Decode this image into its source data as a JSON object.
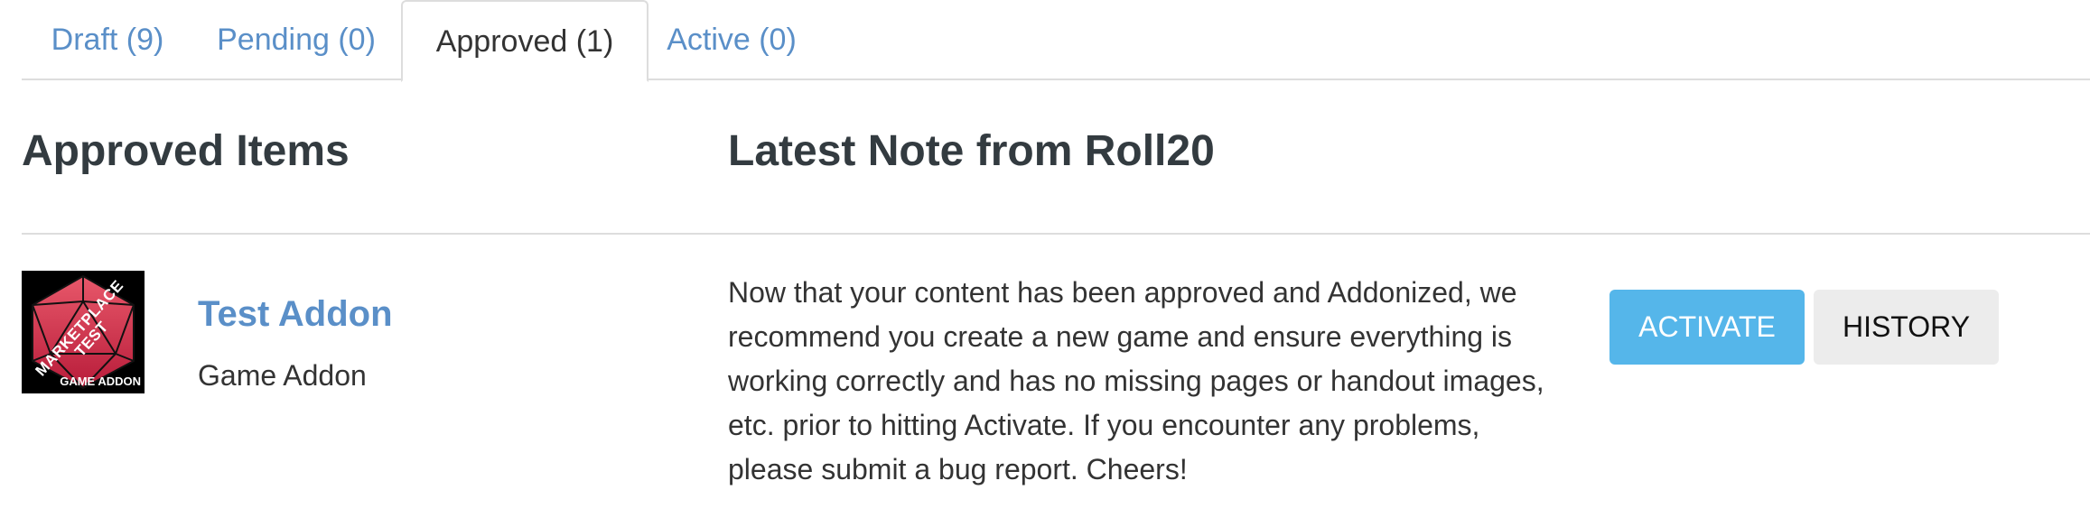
{
  "tabs": [
    {
      "label": "Draft (9)",
      "active": false
    },
    {
      "label": "Pending (0)",
      "active": false
    },
    {
      "label": "Approved (1)",
      "active": true
    },
    {
      "label": "Active (0)",
      "active": false
    }
  ],
  "left_section": {
    "heading": "Approved Items"
  },
  "right_section": {
    "heading": "Latest Note from Roll20"
  },
  "item": {
    "thumbnail_text": "MARKETPLACE TEST",
    "thumbnail_caption": "GAME ADDON",
    "title": "Test Addon",
    "type": "Game Addon",
    "note": "Now that your content has been approved and Addonized, we recommend you create a new game and ensure everything is working correctly and has no missing pages or handout images, etc. prior to hitting Activate. If you encounter any problems, please submit a bug report. Cheers!",
    "buttons": {
      "activate": "ACTIVATE",
      "history": "HISTORY"
    }
  },
  "colors": {
    "link": "#5a8fc8",
    "activate_button": "#55b6ea",
    "history_button": "#ececec",
    "heading": "#333b40"
  }
}
